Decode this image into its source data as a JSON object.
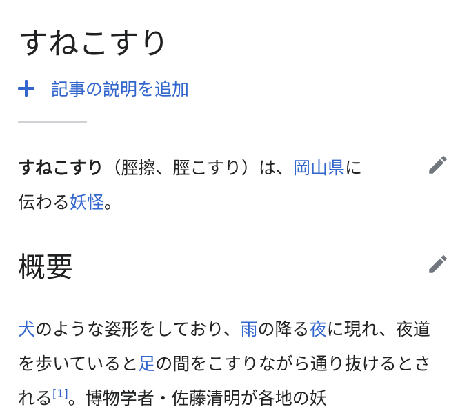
{
  "article": {
    "title": "すねこすり",
    "add_description_label": "記事の説明を追加"
  },
  "lead": {
    "bold_term": "すねこすり",
    "text_1": "（脛擦、脛こすり）は、",
    "link_1": "岡山県",
    "text_2": "に伝わる",
    "link_2": "妖怪",
    "text_3": "。"
  },
  "section": {
    "heading": "概要",
    "p_link_1": "犬",
    "p_text_1": "のような姿形をしており、",
    "p_link_2": "雨",
    "p_text_2": "の降る",
    "p_link_3": "夜",
    "p_text_3": "に現れ、夜道を歩いていると",
    "p_link_4": "足",
    "p_text_4": "の間をこすりながら通り抜けるとされる",
    "p_ref": "[1]",
    "p_text_5": "。博物学者・佐藤清明が各地の妖"
  },
  "icons": {
    "add": "plus-icon",
    "edit": "pencil-icon"
  },
  "colors": {
    "link": "#3366cc",
    "text": "#202122",
    "icon": "#72777d",
    "divider": "#d0d2d6"
  }
}
